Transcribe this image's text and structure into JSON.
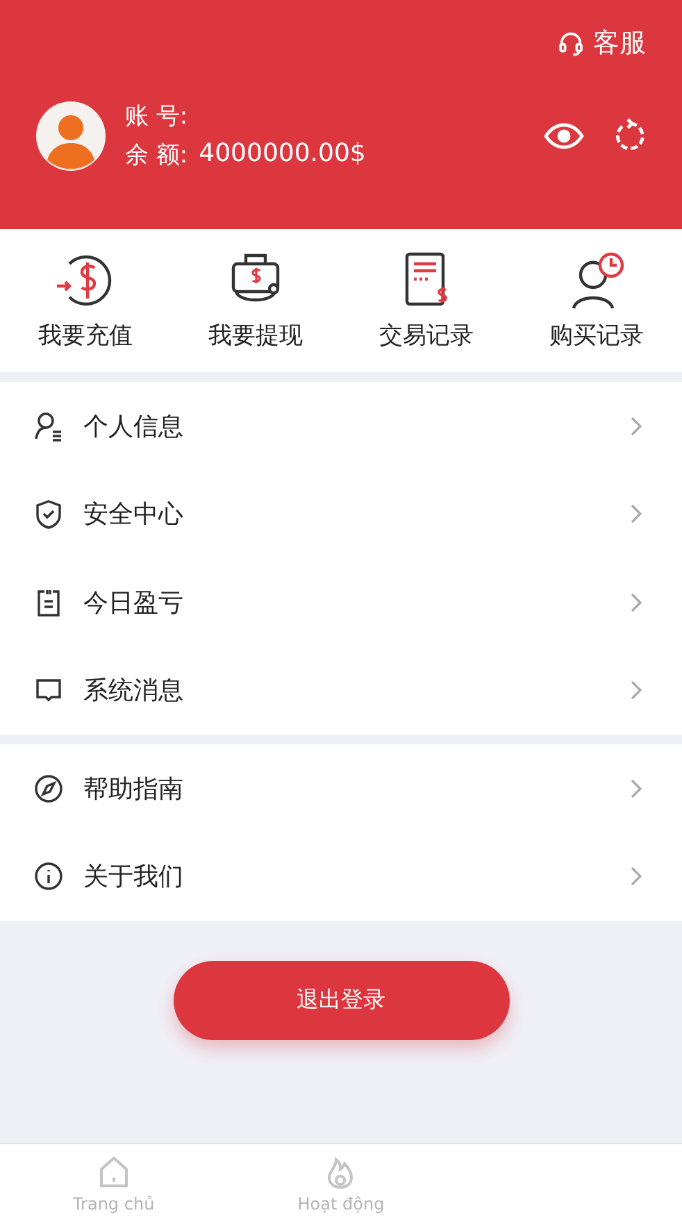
{
  "header": {
    "service_label": "客服",
    "account_label": "账 号:",
    "balance_label": "余 额:",
    "balance": "4000000.00$"
  },
  "actions": [
    {
      "kind": "deposit",
      "label": "我要充值"
    },
    {
      "kind": "withdraw",
      "label": "我要提现"
    },
    {
      "kind": "transactions",
      "label": "交易记录"
    },
    {
      "kind": "purchases",
      "label": "购买记录"
    }
  ],
  "menu_groups": [
    [
      {
        "kind": "profile",
        "label": "个人信息"
      },
      {
        "kind": "security",
        "label": "安全中心"
      },
      {
        "kind": "pnl",
        "label": "今日盈亏"
      },
      {
        "kind": "message",
        "label": "系统消息"
      }
    ],
    [
      {
        "kind": "help",
        "label": "帮助指南"
      },
      {
        "kind": "info",
        "label": "关于我们"
      }
    ]
  ],
  "logout": "退出登录",
  "tabs": [
    {
      "kind": "home",
      "label": "Trang chủ"
    },
    {
      "kind": "activity",
      "label": "Hoạt động"
    }
  ]
}
